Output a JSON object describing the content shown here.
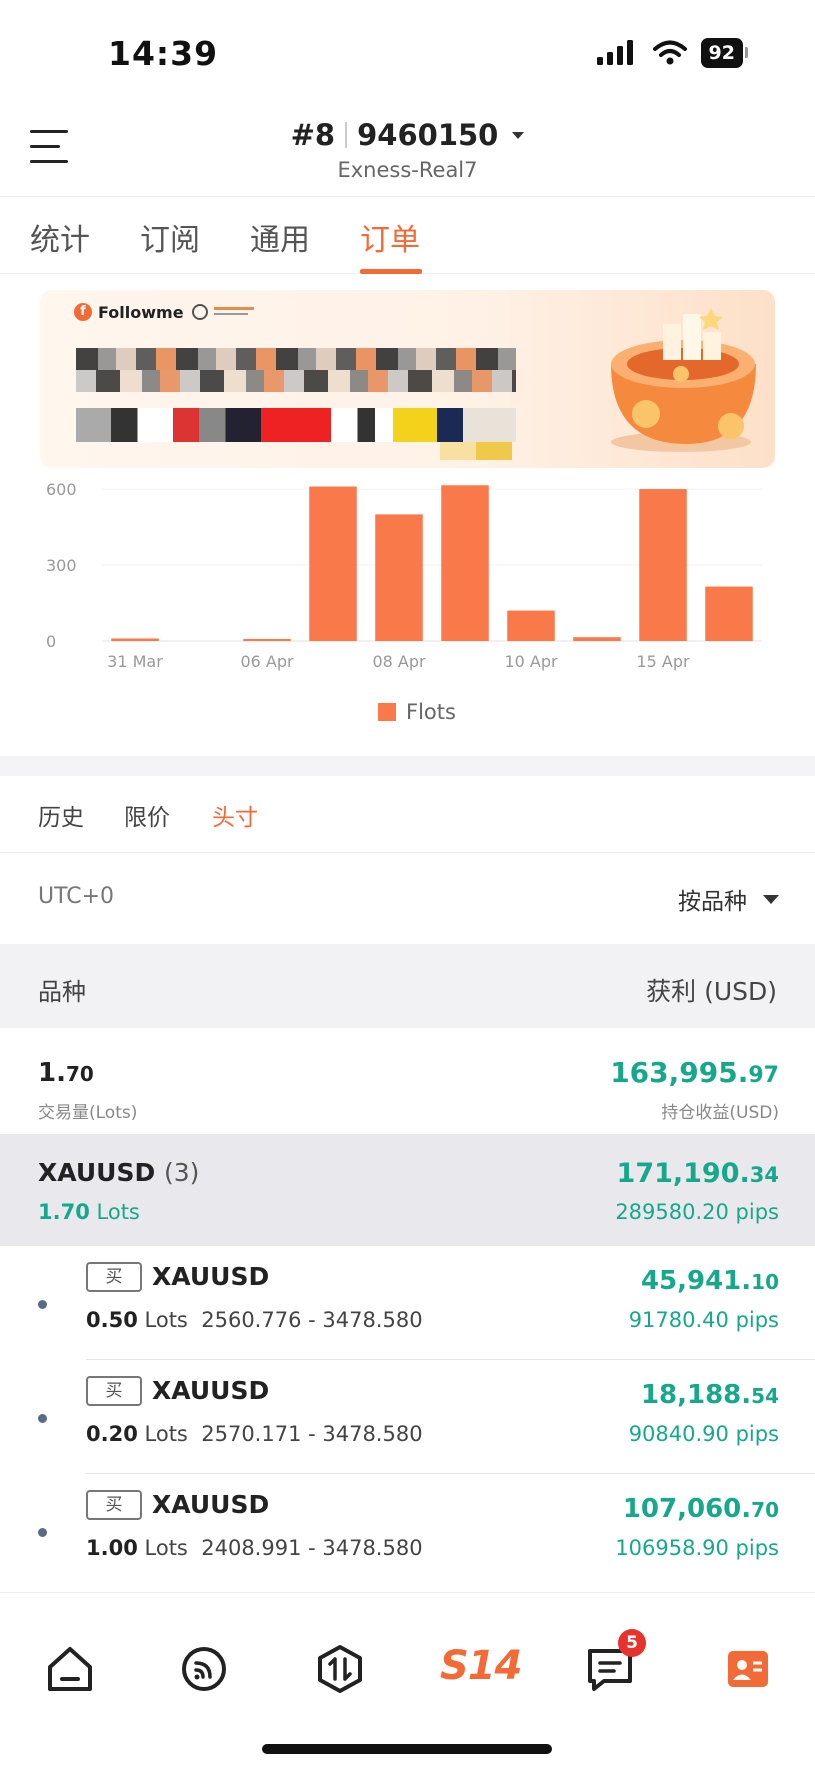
{
  "status": {
    "time": "14:39",
    "battery": "92"
  },
  "header": {
    "account_prefix": "#8",
    "account_number": "9460150",
    "server": "Exness-Real7"
  },
  "tabs": [
    {
      "label": "统计"
    },
    {
      "label": "订阅"
    },
    {
      "label": "通用"
    },
    {
      "label": "订单",
      "active": true
    }
  ],
  "banner": {
    "brand": "Followme"
  },
  "chart_data": {
    "type": "bar",
    "categories": [
      "31 Mar",
      "",
      "06 Apr",
      "",
      "08 Apr",
      "",
      "10 Apr",
      "",
      "15 Apr",
      ""
    ],
    "values": [
      10,
      0,
      8,
      610,
      500,
      615,
      120,
      15,
      600,
      215
    ],
    "series": [
      {
        "name": "Flots",
        "values": [
          10,
          0,
          8,
          610,
          500,
          615,
          120,
          15,
          600,
          215
        ]
      }
    ],
    "yticks": [
      "0",
      "300",
      "600"
    ],
    "ylim": [
      0,
      620
    ],
    "xlabel": "",
    "ylabel": "",
    "legend": "bottom",
    "color": "#f9794a"
  },
  "subtabs": [
    {
      "label": "历史"
    },
    {
      "label": "限价"
    },
    {
      "label": "头寸",
      "active": true
    }
  ],
  "filters": {
    "timezone": "UTC+0",
    "sort_by": "按品种"
  },
  "table_header": {
    "left": "品种",
    "right": "获利 (USD)"
  },
  "summary": {
    "lots_int": "1.",
    "lots_dec": "70",
    "lots_label": "交易量(Lots)",
    "profit_int": "163,995.",
    "profit_dec": "97",
    "profit_label": "持仓收益(USD)"
  },
  "group": {
    "symbol": "XAUUSD",
    "count": "(3)",
    "lots_value": "1.70",
    "lots_unit": "Lots",
    "profit_int": "171,190.",
    "profit_dec": "34",
    "pips": "289580.20 pips"
  },
  "positions": [
    {
      "side": "买",
      "symbol": "XAUUSD",
      "lots": "0.50",
      "lots_unit": "Lots",
      "range": "2560.776 - 3478.580",
      "profit_int": "45,941.",
      "profit_dec": "10",
      "pips": "91780.40 pips"
    },
    {
      "side": "买",
      "symbol": "XAUUSD",
      "lots": "0.20",
      "lots_unit": "Lots",
      "range": "2570.171 - 3478.580",
      "profit_int": "18,188.",
      "profit_dec": "54",
      "pips": "90840.90 pips"
    },
    {
      "side": "买",
      "symbol": "XAUUSD",
      "lots": "1.00",
      "lots_unit": "Lots",
      "range": "2408.991 - 3478.580",
      "profit_int": "107,060.",
      "profit_dec": "70",
      "pips": "106958.90 pips"
    }
  ],
  "bottom_nav": {
    "s14_label": "S14",
    "messages_badge": "5"
  },
  "colors": {
    "accent": "#f26a36",
    "profit": "#17a88b",
    "bar": "#f9794a"
  }
}
